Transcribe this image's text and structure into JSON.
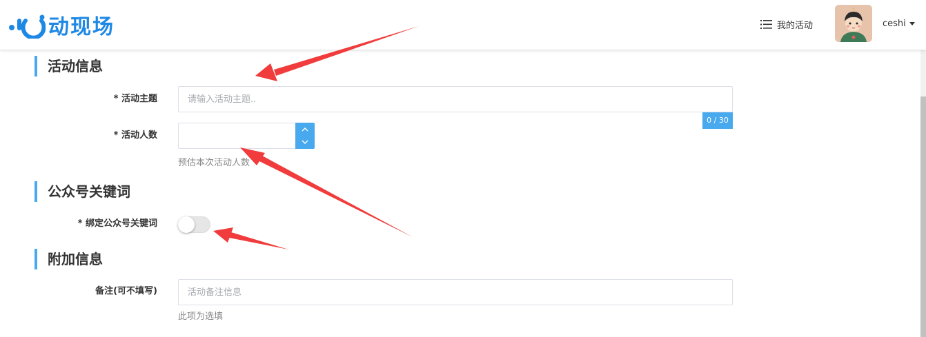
{
  "header": {
    "logo_text": "动现场",
    "nav_my_activities": "我的活动",
    "username": "ceshi"
  },
  "sections": {
    "activity_info": "活动信息",
    "wechat_keyword": "公众号关键词",
    "extra_info": "附加信息"
  },
  "form": {
    "topic_label": "* 活动主题",
    "topic_placeholder": "请输入活动主题..",
    "topic_counter": "0 / 30",
    "count_label": "* 活动人数",
    "count_value": "",
    "count_hint": "预估本次活动人数",
    "keyword_label": "* 绑定公众号关键词",
    "keyword_enabled": false,
    "remark_label": "备注(可不填写)",
    "remark_placeholder": "活动备注信息",
    "remark_hint": "此项为选填"
  },
  "icons": {
    "list": "list-icon",
    "caret": "caret-down-icon",
    "up": "chevron-up-icon",
    "down": "chevron-down-icon"
  },
  "colors": {
    "brand": "#1e88e5",
    "accent": "#49a9ee",
    "annotation_arrow": "#f03c3c"
  }
}
